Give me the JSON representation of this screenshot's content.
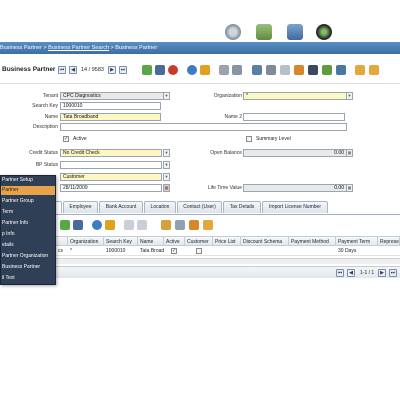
{
  "breadcrumb": {
    "part1": "Business Partner",
    "sep1": " > ",
    "part2": "Business Partner Search",
    "sep2": " > ",
    "part3": "Business Partner"
  },
  "toolbar": {
    "title": "Business Partner",
    "record_counter": "14 / 9583"
  },
  "form": {
    "tenant_label": "Tenant",
    "tenant_value": "CPC Diagnostics",
    "organization_label": "Organization",
    "organization_value": "*",
    "search_key_label": "Search Key",
    "search_key_value": "1000010",
    "name_label": "Name",
    "name_value": "Tata Broadband",
    "name2_label": "Name 2",
    "name2_value": "",
    "description_label": "Description",
    "description_value": "",
    "active_label": "Active",
    "summary_level_label": "Summary Level",
    "credit_status_label": "Credit Status",
    "credit_status_value": "No Credit Check",
    "open_balance_label": "Open Balance",
    "open_balance_value": "0.00",
    "bp_status_label": "BP Status",
    "bp_status_value": "",
    "group_value": "Customer",
    "date_value": "28/11/2009",
    "lifetime_value_label": "Life Time Value",
    "lifetime_value_value": "0.00"
  },
  "tabs": [
    "Employee",
    "Bank Account",
    "Location",
    "Contact (User)",
    "Tax Details",
    "Import License Number"
  ],
  "grid": {
    "headers": [
      "Organization",
      "Search Key",
      "Name",
      "Active",
      "Customer",
      "Price List",
      "Discount Schema",
      "Payment Method",
      "Payment Term",
      "Represe"
    ],
    "row": {
      "tenant": "cs",
      "organization": "*",
      "search_key": "1000010",
      "name": "Tata Broad",
      "payment_term": "30 Days"
    },
    "pager": "1-1 / 1"
  },
  "menu": {
    "items": [
      "Partner Setup",
      "Partner",
      "Partner Group",
      "Term",
      "Partner Info",
      "p Info",
      "etails",
      "Partner Organization",
      "Business Partner",
      "il Text"
    ],
    "selected_index": 1
  },
  "colors": {
    "crumb_bar": "#4a7fb5",
    "menu_bg": "#2f3f55",
    "menu_selected": "#e8a34a",
    "mandatory_field": "#fdf7c3"
  }
}
